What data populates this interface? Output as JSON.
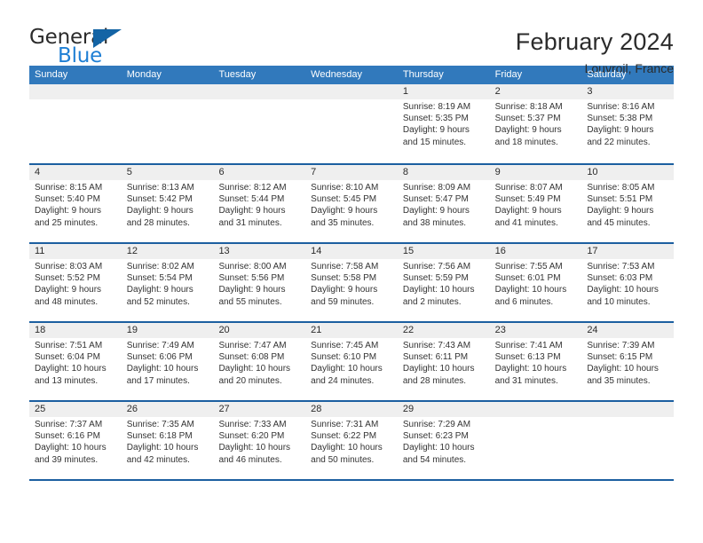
{
  "brand": {
    "word_one": "General",
    "word_two": "Blue",
    "triangle_color": "#1464a5",
    "blue_color": "#1f7fd4"
  },
  "header": {
    "title": "February 2024",
    "location": "Louvroil, France"
  },
  "theme": {
    "header_blue": "#3179bc",
    "rule_blue": "#1c5fa0",
    "daynum_band": "#efefef"
  },
  "weekdays": [
    "Sunday",
    "Monday",
    "Tuesday",
    "Wednesday",
    "Thursday",
    "Friday",
    "Saturday"
  ],
  "weeks": [
    [
      {
        "day": "",
        "lines": []
      },
      {
        "day": "",
        "lines": []
      },
      {
        "day": "",
        "lines": []
      },
      {
        "day": "",
        "lines": []
      },
      {
        "day": "1",
        "lines": [
          "Sunrise: 8:19 AM",
          "Sunset: 5:35 PM",
          "Daylight: 9 hours",
          "and 15 minutes."
        ]
      },
      {
        "day": "2",
        "lines": [
          "Sunrise: 8:18 AM",
          "Sunset: 5:37 PM",
          "Daylight: 9 hours",
          "and 18 minutes."
        ]
      },
      {
        "day": "3",
        "lines": [
          "Sunrise: 8:16 AM",
          "Sunset: 5:38 PM",
          "Daylight: 9 hours",
          "and 22 minutes."
        ]
      }
    ],
    [
      {
        "day": "4",
        "lines": [
          "Sunrise: 8:15 AM",
          "Sunset: 5:40 PM",
          "Daylight: 9 hours",
          "and 25 minutes."
        ]
      },
      {
        "day": "5",
        "lines": [
          "Sunrise: 8:13 AM",
          "Sunset: 5:42 PM",
          "Daylight: 9 hours",
          "and 28 minutes."
        ]
      },
      {
        "day": "6",
        "lines": [
          "Sunrise: 8:12 AM",
          "Sunset: 5:44 PM",
          "Daylight: 9 hours",
          "and 31 minutes."
        ]
      },
      {
        "day": "7",
        "lines": [
          "Sunrise: 8:10 AM",
          "Sunset: 5:45 PM",
          "Daylight: 9 hours",
          "and 35 minutes."
        ]
      },
      {
        "day": "8",
        "lines": [
          "Sunrise: 8:09 AM",
          "Sunset: 5:47 PM",
          "Daylight: 9 hours",
          "and 38 minutes."
        ]
      },
      {
        "day": "9",
        "lines": [
          "Sunrise: 8:07 AM",
          "Sunset: 5:49 PM",
          "Daylight: 9 hours",
          "and 41 minutes."
        ]
      },
      {
        "day": "10",
        "lines": [
          "Sunrise: 8:05 AM",
          "Sunset: 5:51 PM",
          "Daylight: 9 hours",
          "and 45 minutes."
        ]
      }
    ],
    [
      {
        "day": "11",
        "lines": [
          "Sunrise: 8:03 AM",
          "Sunset: 5:52 PM",
          "Daylight: 9 hours",
          "and 48 minutes."
        ]
      },
      {
        "day": "12",
        "lines": [
          "Sunrise: 8:02 AM",
          "Sunset: 5:54 PM",
          "Daylight: 9 hours",
          "and 52 minutes."
        ]
      },
      {
        "day": "13",
        "lines": [
          "Sunrise: 8:00 AM",
          "Sunset: 5:56 PM",
          "Daylight: 9 hours",
          "and 55 minutes."
        ]
      },
      {
        "day": "14",
        "lines": [
          "Sunrise: 7:58 AM",
          "Sunset: 5:58 PM",
          "Daylight: 9 hours",
          "and 59 minutes."
        ]
      },
      {
        "day": "15",
        "lines": [
          "Sunrise: 7:56 AM",
          "Sunset: 5:59 PM",
          "Daylight: 10 hours",
          "and 2 minutes."
        ]
      },
      {
        "day": "16",
        "lines": [
          "Sunrise: 7:55 AM",
          "Sunset: 6:01 PM",
          "Daylight: 10 hours",
          "and 6 minutes."
        ]
      },
      {
        "day": "17",
        "lines": [
          "Sunrise: 7:53 AM",
          "Sunset: 6:03 PM",
          "Daylight: 10 hours",
          "and 10 minutes."
        ]
      }
    ],
    [
      {
        "day": "18",
        "lines": [
          "Sunrise: 7:51 AM",
          "Sunset: 6:04 PM",
          "Daylight: 10 hours",
          "and 13 minutes."
        ]
      },
      {
        "day": "19",
        "lines": [
          "Sunrise: 7:49 AM",
          "Sunset: 6:06 PM",
          "Daylight: 10 hours",
          "and 17 minutes."
        ]
      },
      {
        "day": "20",
        "lines": [
          "Sunrise: 7:47 AM",
          "Sunset: 6:08 PM",
          "Daylight: 10 hours",
          "and 20 minutes."
        ]
      },
      {
        "day": "21",
        "lines": [
          "Sunrise: 7:45 AM",
          "Sunset: 6:10 PM",
          "Daylight: 10 hours",
          "and 24 minutes."
        ]
      },
      {
        "day": "22",
        "lines": [
          "Sunrise: 7:43 AM",
          "Sunset: 6:11 PM",
          "Daylight: 10 hours",
          "and 28 minutes."
        ]
      },
      {
        "day": "23",
        "lines": [
          "Sunrise: 7:41 AM",
          "Sunset: 6:13 PM",
          "Daylight: 10 hours",
          "and 31 minutes."
        ]
      },
      {
        "day": "24",
        "lines": [
          "Sunrise: 7:39 AM",
          "Sunset: 6:15 PM",
          "Daylight: 10 hours",
          "and 35 minutes."
        ]
      }
    ],
    [
      {
        "day": "25",
        "lines": [
          "Sunrise: 7:37 AM",
          "Sunset: 6:16 PM",
          "Daylight: 10 hours",
          "and 39 minutes."
        ]
      },
      {
        "day": "26",
        "lines": [
          "Sunrise: 7:35 AM",
          "Sunset: 6:18 PM",
          "Daylight: 10 hours",
          "and 42 minutes."
        ]
      },
      {
        "day": "27",
        "lines": [
          "Sunrise: 7:33 AM",
          "Sunset: 6:20 PM",
          "Daylight: 10 hours",
          "and 46 minutes."
        ]
      },
      {
        "day": "28",
        "lines": [
          "Sunrise: 7:31 AM",
          "Sunset: 6:22 PM",
          "Daylight: 10 hours",
          "and 50 minutes."
        ]
      },
      {
        "day": "29",
        "lines": [
          "Sunrise: 7:29 AM",
          "Sunset: 6:23 PM",
          "Daylight: 10 hours",
          "and 54 minutes."
        ]
      },
      {
        "day": "",
        "lines": []
      },
      {
        "day": "",
        "lines": []
      }
    ]
  ]
}
